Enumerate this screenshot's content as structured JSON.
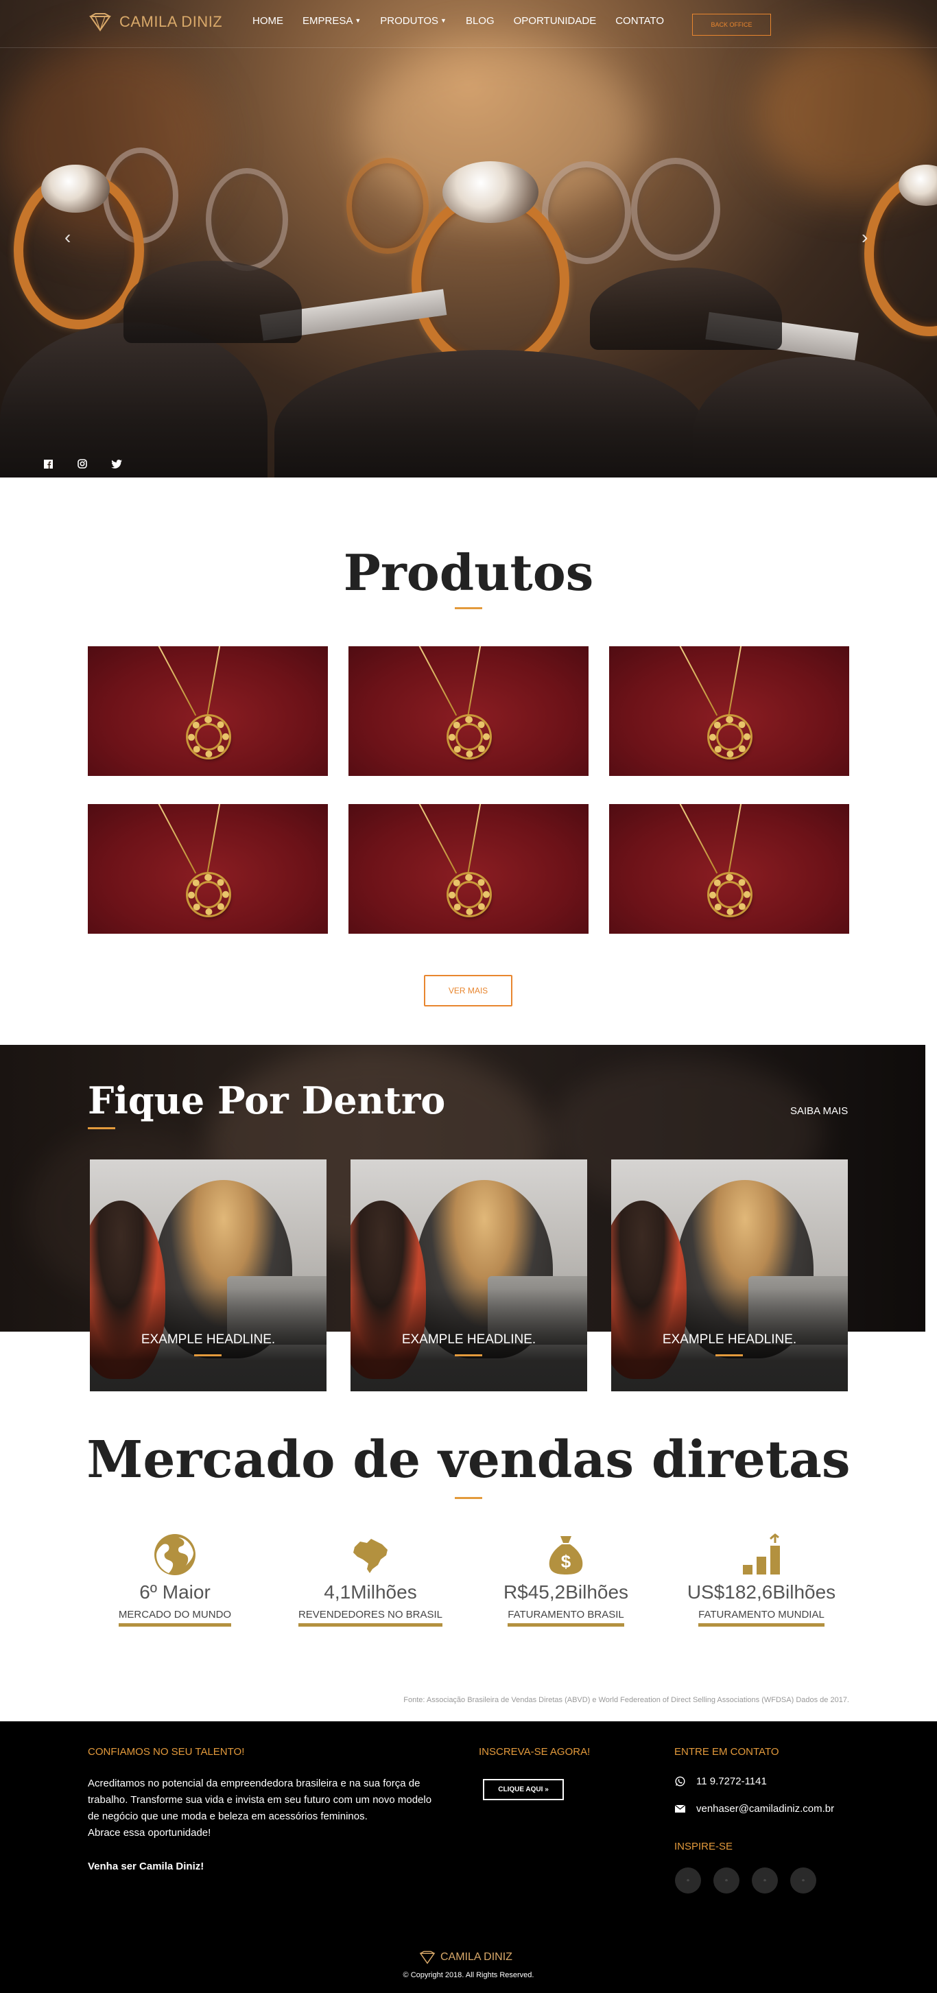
{
  "brand": {
    "name": "CAMILA DINIZ"
  },
  "nav": {
    "items": [
      {
        "label": "HOME",
        "dropdown": false
      },
      {
        "label": "EMPRESA",
        "dropdown": true
      },
      {
        "label": "PRODUTOS",
        "dropdown": true
      },
      {
        "label": "BLOG",
        "dropdown": false
      },
      {
        "label": "OPORTUNIDADE",
        "dropdown": false
      },
      {
        "label": "CONTATO",
        "dropdown": false
      }
    ],
    "cta": "BACK OFFICE"
  },
  "hero": {
    "prev_icon": "chevron-left-icon",
    "next_icon": "chevron-right-icon",
    "social_icons": [
      "facebook-icon",
      "instagram-icon",
      "twitter-icon"
    ]
  },
  "produtos": {
    "title": "Produtos",
    "count": 6,
    "button": "VER MAIS"
  },
  "fique": {
    "title": "Fique Por Dentro",
    "link": "SAIBA MAIS",
    "cards": [
      {
        "headline": "EXAMPLE HEADLINE."
      },
      {
        "headline": "EXAMPLE HEADLINE."
      },
      {
        "headline": "EXAMPLE HEADLINE."
      }
    ]
  },
  "mercado": {
    "title": "Mercado de vendas diretas",
    "stats": [
      {
        "icon": "globe-icon",
        "value": "6º Maior",
        "label": "MERCADO DO MUNDO"
      },
      {
        "icon": "brazil-map-icon",
        "value": "4,1Milhões",
        "label": "REVENDEDORES NO BRASIL"
      },
      {
        "icon": "money-bag-icon",
        "value": "R$45,2Bilhões",
        "label": "FATURAMENTO BRASIL"
      },
      {
        "icon": "growth-chart-icon",
        "value": "US$182,6Bilhões",
        "label": "FATURAMENTO MUNDIAL"
      }
    ],
    "source": "Fonte: Associação Brasileira de Vendas Diretas (ABVD) e World Federeation of Direct Selling Associations (WFDSA) Dados de 2017."
  },
  "footer": {
    "talent_heading": "CONFIAMOS NO SEU TALENTO!",
    "talent_lines": [
      "Acreditamos no potencial da empreendedora brasileira e na sua força de",
      "trabalho. Transforme sua vida e invista em seu futuro com um novo modelo",
      "de negócio que une moda e beleza em acessórios femininos.",
      "Abrace essa oportunidade!"
    ],
    "talent_cta": "Venha ser Camila Diniz!",
    "subscribe_heading": "INSCREVA-SE AGORA!",
    "subscribe_button": "CLIQUE AQUI »",
    "contact_heading": "ENTRE EM CONTATO",
    "phone": "11 9.7272-1141",
    "email": "venhaser@camiladiniz.com.br",
    "inspire_heading": "INSPIRE-SE",
    "inspire_icons": [
      "facebook-icon",
      "instagram-icon",
      "twitter-icon",
      "youtube-icon"
    ],
    "brand": "CAMILA DINIZ",
    "copyright": "© Copyright 2018. All Rights Reserved."
  },
  "colors": {
    "accent": "#e39a3c",
    "gold": "#b3913f",
    "brand_text": "#d9a96a",
    "product_bg": "#7a161c"
  }
}
